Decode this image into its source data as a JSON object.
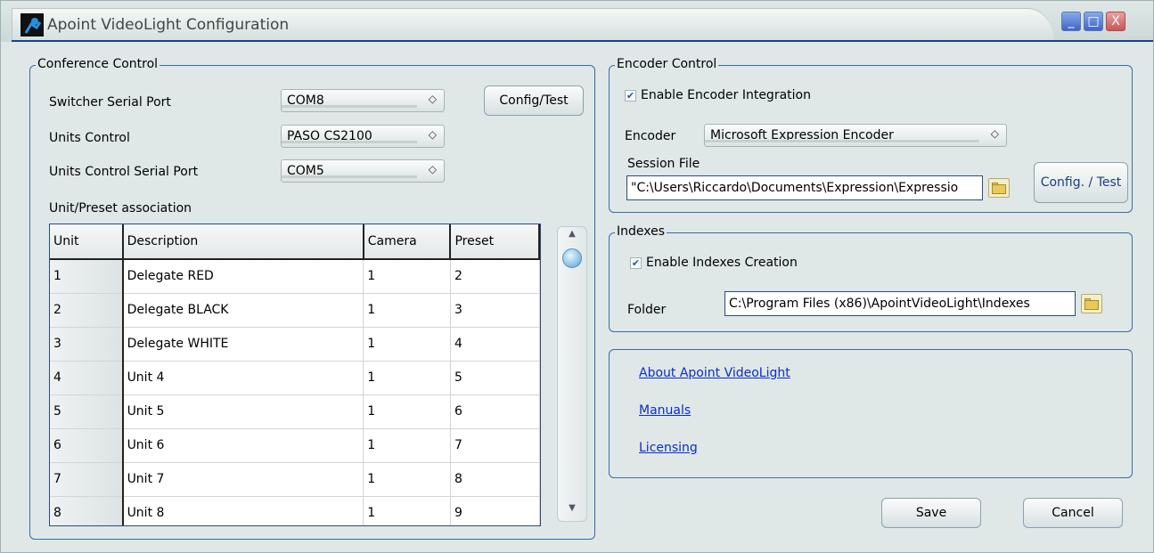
{
  "window": {
    "title": "Apoint VideoLight Configuration",
    "controls": {
      "minimize": "_",
      "maximize": "□",
      "close": "X"
    }
  },
  "conference": {
    "legend": "Conference Control",
    "switcher_label": "Switcher Serial Port",
    "switcher_value": "COM8",
    "units_control_label": "Units Control",
    "units_control_value": "PASO CS2100",
    "units_port_label": "Units Control Serial Port",
    "units_port_value": "COM5",
    "config_test_label": "Config/Test",
    "association_label": "Unit/Preset association",
    "table": {
      "headers": [
        "Unit",
        "Description",
        "Camera",
        "Preset"
      ],
      "rows": [
        [
          "1",
          "Delegate RED",
          "1",
          "2"
        ],
        [
          "2",
          "Delegate BLACK",
          "1",
          "3"
        ],
        [
          "3",
          "Delegate WHITE",
          "1",
          "4"
        ],
        [
          "4",
          "Unit 4",
          "1",
          "5"
        ],
        [
          "5",
          "Unit 5",
          "1",
          "6"
        ],
        [
          "6",
          "Unit 6",
          "1",
          "7"
        ],
        [
          "7",
          "Unit 7",
          "1",
          "8"
        ],
        [
          "8",
          "Unit 8",
          "1",
          "9"
        ]
      ]
    }
  },
  "encoder": {
    "legend": "Encoder Control",
    "enable_label": "Enable Encoder Integration",
    "enable_checked": true,
    "encoder_label": "Encoder",
    "encoder_value": "Microsoft Expression Encoder",
    "session_label": "Session File",
    "session_value": "\"C:\\Users\\Riccardo\\Documents\\Expression\\Expressio",
    "config_test_label": "Config. / Test"
  },
  "indexes": {
    "legend": "Indexes",
    "enable_label": "Enable Indexes Creation",
    "enable_checked": true,
    "folder_label": "Folder",
    "folder_value": "C:\\Program Files (x86)\\ApointVideoLight\\Indexes"
  },
  "links": {
    "about": "About Apoint VideoLight",
    "manuals": "Manuals",
    "licensing": "Licensing"
  },
  "actions": {
    "save": "Save",
    "cancel": "Cancel"
  },
  "colors": {
    "window_bg": "#dfe8e6",
    "group_border": "#3b6aa8",
    "link": "#0a2bd1"
  }
}
